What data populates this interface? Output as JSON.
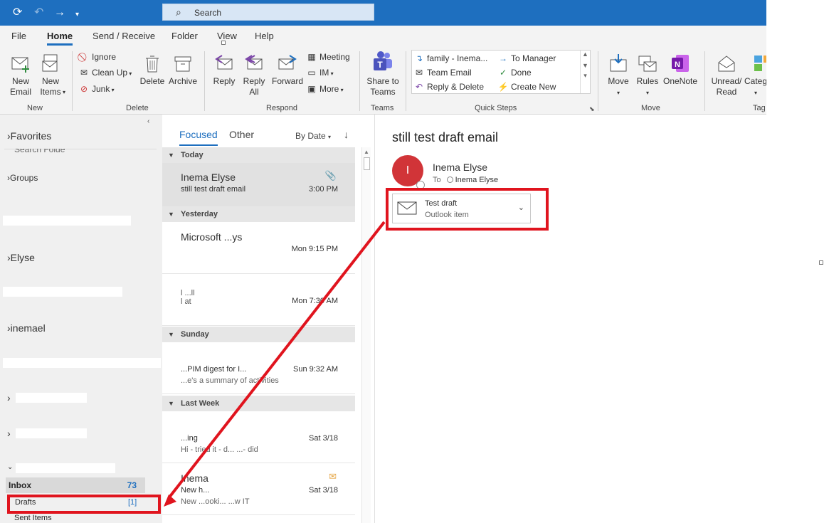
{
  "titlebar": {
    "search_placeholder": "Search"
  },
  "menu": {
    "tabs": [
      "File",
      "Home",
      "Send / Receive",
      "Folder",
      "View",
      "Help"
    ]
  },
  "ribbon": {
    "new_email": "New\nEmail",
    "new_items": "New\nItems",
    "ignore": "Ignore",
    "clean_up": "Clean Up",
    "junk": "Junk",
    "delete": "Delete",
    "archive": "Archive",
    "reply": "Reply",
    "reply_all": "Reply\nAll",
    "forward": "Forward",
    "meeting": "Meeting",
    "im": "IM",
    "more": "More",
    "share_to_teams": "Share to\nTeams",
    "quick_steps": [
      "family - Inema...",
      "To Manager",
      "Team Email",
      "Done",
      "Reply & Delete",
      "Create New"
    ],
    "move": "Move",
    "rules": "Rules",
    "onenote": "OneNote",
    "unread_read": "Unread/\nRead",
    "categorize": "Categ",
    "groups": [
      "New",
      "Delete",
      "Respond",
      "Teams",
      "Quick Steps",
      "Move",
      "Tag"
    ]
  },
  "folders": {
    "favorites": "Favorites",
    "search_folders": "Search Folders",
    "groups": "Groups",
    "elyse": "Elyse",
    "inemael": "inemael",
    "inbox": "Inbox",
    "inbox_count": "73",
    "drafts": "Drafts",
    "drafts_count": "[1]",
    "sent_items": "Sent Items"
  },
  "msglist": {
    "tab_focused": "Focused",
    "tab_other": "Other",
    "sort": "By Date",
    "groups": [
      "Today",
      "Yesterday",
      "Sunday",
      "Last Week"
    ],
    "messages": [
      {
        "from": "Inema Elyse",
        "subject": "still test draft email",
        "preview": "",
        "time": "3:00 PM"
      },
      {
        "from": "Microsoft ...ys",
        "subject": "",
        "preview": "",
        "time": "Mon 9:15 PM"
      },
      {
        "from": "",
        "subject": "",
        "preview": "",
        "time": "Mon 7:30 AM"
      },
      {
        "from": "",
        "subject": "...PIM digest for I...",
        "preview": "...e's a summary of activities",
        "time": "Sun 9:32 AM"
      },
      {
        "from": "",
        "subject": "...ing",
        "preview": "Hi - tried it - d... ...- did",
        "time": "Sat 3/18"
      },
      {
        "from": "Inema",
        "subject": "New h...",
        "preview": "New ...ooki... ...w IT",
        "time": "Sat 3/18"
      }
    ]
  },
  "reading": {
    "subject": "still test draft email",
    "avatar_initial": "I",
    "sender": "Inema Elyse",
    "to_label": "To",
    "recipient": "Inema Elyse",
    "attachment_name": "Test draft",
    "attachment_type": "Outlook item"
  },
  "colors": {
    "accent": "#1e6fbf",
    "annotation": "#e0141e",
    "avatar": "#d13438"
  }
}
